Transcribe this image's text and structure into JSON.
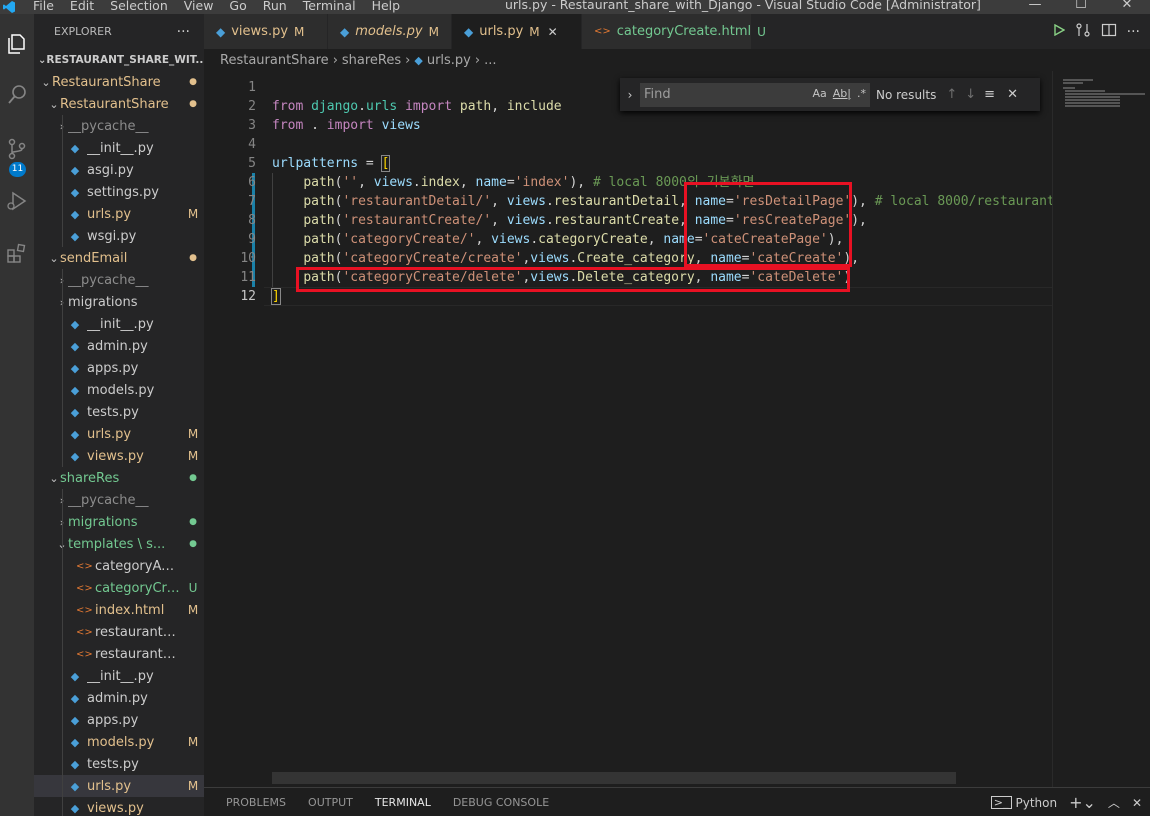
{
  "window": {
    "title": "urls.py - Restaurant_share_with_Django - Visual Studio Code [Administrator]",
    "menu": [
      "File",
      "Edit",
      "Selection",
      "View",
      "Go",
      "Run",
      "Terminal",
      "Help"
    ],
    "controls": [
      "—",
      "☐",
      "✕"
    ]
  },
  "activity": {
    "scm_badge": "11"
  },
  "explorer": {
    "header": "EXPLORER",
    "more": "···",
    "section": "RESTAURANT_SHARE_WIT...",
    "items": [
      {
        "label": "RestaurantShare",
        "depth": 0,
        "kind": "folder-open",
        "deco": "●",
        "color": "#e2c08d"
      },
      {
        "label": "RestaurantShare",
        "depth": 1,
        "kind": "folder-open",
        "deco": "●",
        "color": "#e2c08d"
      },
      {
        "label": "__pycache__",
        "depth": 2,
        "kind": "folder",
        "deco": "",
        "color": "#8c8c8c"
      },
      {
        "label": "__init__.py",
        "depth": 2,
        "kind": "py",
        "deco": "",
        "color": "#cccccc"
      },
      {
        "label": "asgi.py",
        "depth": 2,
        "kind": "py",
        "deco": "",
        "color": "#cccccc"
      },
      {
        "label": "settings.py",
        "depth": 2,
        "kind": "py",
        "deco": "",
        "color": "#cccccc"
      },
      {
        "label": "urls.py",
        "depth": 2,
        "kind": "py",
        "deco": "M",
        "color": "#e2c08d"
      },
      {
        "label": "wsgi.py",
        "depth": 2,
        "kind": "py",
        "deco": "",
        "color": "#cccccc"
      },
      {
        "label": "sendEmail",
        "depth": 1,
        "kind": "folder-open",
        "deco": "●",
        "color": "#e2c08d"
      },
      {
        "label": "__pycache__",
        "depth": 2,
        "kind": "folder",
        "deco": "",
        "color": "#8c8c8c"
      },
      {
        "label": "migrations",
        "depth": 2,
        "kind": "folder",
        "deco": "",
        "color": "#cccccc"
      },
      {
        "label": "__init__.py",
        "depth": 2,
        "kind": "py",
        "deco": "",
        "color": "#cccccc"
      },
      {
        "label": "admin.py",
        "depth": 2,
        "kind": "py",
        "deco": "",
        "color": "#cccccc"
      },
      {
        "label": "apps.py",
        "depth": 2,
        "kind": "py",
        "deco": "",
        "color": "#cccccc"
      },
      {
        "label": "models.py",
        "depth": 2,
        "kind": "py",
        "deco": "",
        "color": "#cccccc"
      },
      {
        "label": "tests.py",
        "depth": 2,
        "kind": "py",
        "deco": "",
        "color": "#cccccc"
      },
      {
        "label": "urls.py",
        "depth": 2,
        "kind": "py",
        "deco": "M",
        "color": "#e2c08d"
      },
      {
        "label": "views.py",
        "depth": 2,
        "kind": "py",
        "deco": "M",
        "color": "#e2c08d"
      },
      {
        "label": "shareRes",
        "depth": 1,
        "kind": "folder-open",
        "deco": "●",
        "color": "#73c991"
      },
      {
        "label": "__pycache__",
        "depth": 2,
        "kind": "folder",
        "deco": "",
        "color": "#8c8c8c"
      },
      {
        "label": "migrations",
        "depth": 2,
        "kind": "folder",
        "deco": "●",
        "color": "#73c991"
      },
      {
        "label": "templates \\ s...",
        "depth": 2,
        "kind": "folder-open",
        "deco": "●",
        "color": "#73c991"
      },
      {
        "label": "categoryAdd.html",
        "depth": 3,
        "kind": "html",
        "deco": "",
        "color": "#cccccc"
      },
      {
        "label": "categoryCre...",
        "depth": 3,
        "kind": "html",
        "deco": "U",
        "color": "#73c991"
      },
      {
        "label": "index.html",
        "depth": 3,
        "kind": "html",
        "deco": "M",
        "color": "#e2c08d"
      },
      {
        "label": "restaurantCreate....",
        "depth": 3,
        "kind": "html",
        "deco": "",
        "color": "#cccccc"
      },
      {
        "label": "restaurantDetail.h...",
        "depth": 3,
        "kind": "html",
        "deco": "",
        "color": "#cccccc"
      },
      {
        "label": "__init__.py",
        "depth": 2,
        "kind": "py",
        "deco": "",
        "color": "#cccccc"
      },
      {
        "label": "admin.py",
        "depth": 2,
        "kind": "py",
        "deco": "",
        "color": "#cccccc"
      },
      {
        "label": "apps.py",
        "depth": 2,
        "kind": "py",
        "deco": "",
        "color": "#cccccc"
      },
      {
        "label": "models.py",
        "depth": 2,
        "kind": "py",
        "deco": "M",
        "color": "#e2c08d"
      },
      {
        "label": "tests.py",
        "depth": 2,
        "kind": "py",
        "deco": "",
        "color": "#cccccc"
      },
      {
        "label": "urls.py",
        "depth": 2,
        "kind": "py",
        "deco": "M",
        "color": "#e2c08d",
        "active": true
      },
      {
        "label": "views.py",
        "depth": 2,
        "kind": "py",
        "deco": "",
        "color": "#e2c08d"
      }
    ]
  },
  "tabs": [
    {
      "label": "views.py",
      "mod": "M",
      "icon": "py",
      "italic": false,
      "active": false,
      "color": "#e2c08d"
    },
    {
      "label": "models.py",
      "mod": "M",
      "icon": "py",
      "italic": true,
      "active": false,
      "color": "#e2c08d"
    },
    {
      "label": "urls.py",
      "mod": "M",
      "icon": "py",
      "italic": false,
      "active": true,
      "color": "#e2c08d"
    },
    {
      "label": "categoryCreate.html",
      "mod": "U",
      "icon": "html",
      "italic": false,
      "active": false,
      "color": "#73c991"
    }
  ],
  "breadcrumb": [
    "RestaurantShare",
    "shareRes",
    "urls.py",
    "..."
  ],
  "find": {
    "placeholder": "Find",
    "opt_case": "Aa",
    "opt_word": "Ab|",
    "opt_regex": ".*",
    "result": "No results"
  },
  "editor": {
    "line_numbers": [
      "1",
      "2",
      "3",
      "4",
      "5",
      "6",
      "7",
      "8",
      "9",
      "10",
      "11",
      "12"
    ],
    "current_line": 12
  },
  "panel": {
    "tabs": [
      "PROBLEMS",
      "OUTPUT",
      "TERMINAL",
      "DEBUG CONSOLE"
    ],
    "active": "TERMINAL",
    "terminal_name": "Python"
  },
  "colors": {
    "accent": "#007acc",
    "modified": "#e2c08d",
    "untracked": "#73c991",
    "highlight_box": "#e81123"
  }
}
